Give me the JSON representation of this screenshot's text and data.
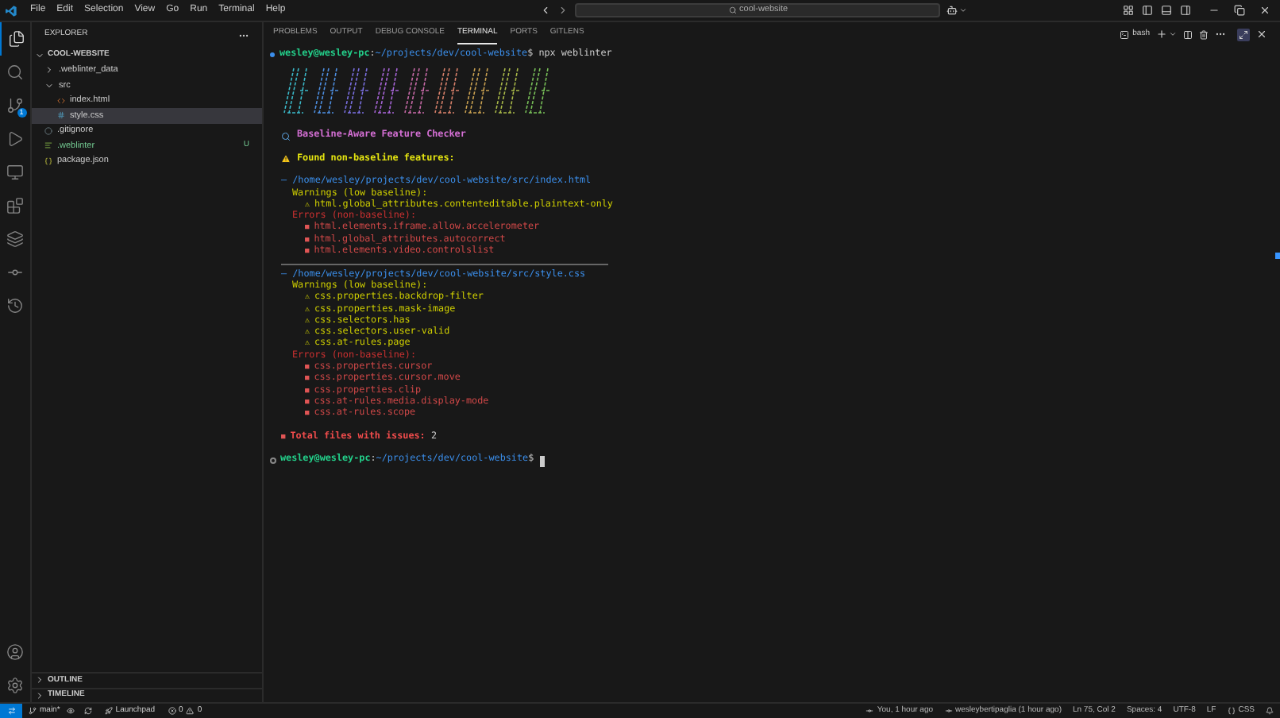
{
  "title_bar": {
    "menus": [
      "File",
      "Edit",
      "Selection",
      "View",
      "Go",
      "Run",
      "Terminal",
      "Help"
    ],
    "search": {
      "value": "cool-website"
    }
  },
  "activity_bar": {
    "items": [
      {
        "selected": true
      },
      {
        "selected": false
      },
      {
        "selected": false,
        "badge": "1"
      },
      {
        "selected": false
      },
      {
        "selected": false
      },
      {
        "selected": false
      },
      {
        "selected": false
      },
      {
        "selected": false
      },
      {
        "selected": false
      }
    ]
  },
  "sidebar": {
    "title": "EXPLORER",
    "root": {
      "label": "COOL-WEBSITE",
      "expanded": true,
      "children": [
        {
          "label": ".weblinter_data",
          "kind": "folder",
          "expanded": false,
          "selected": false
        },
        {
          "label": "src",
          "kind": "folder",
          "expanded": true,
          "selected": false,
          "children": [
            {
              "label": "index.html",
              "kind": "html",
              "selected": false
            },
            {
              "label": "style.css",
              "kind": "css",
              "selected": true
            }
          ]
        },
        {
          "label": ".gitignore",
          "kind": "git",
          "selected": false
        },
        {
          "label": ".weblinter",
          "kind": "config",
          "selected": false,
          "git_status": "U"
        },
        {
          "label": "package.json",
          "kind": "json",
          "selected": false
        }
      ]
    },
    "sections": [
      {
        "label": "OUTLINE",
        "expanded": false
      },
      {
        "label": "TIMELINE",
        "expanded": false
      }
    ]
  },
  "panel": {
    "tabs": [
      {
        "label": "PROBLEMS",
        "selected": false
      },
      {
        "label": "OUTPUT",
        "selected": false
      },
      {
        "label": "DEBUG CONSOLE",
        "selected": false
      },
      {
        "label": "TERMINAL",
        "selected": true
      },
      {
        "label": "PORTS",
        "selected": false
      },
      {
        "label": "GITLENS",
        "selected": false
      }
    ],
    "terminal_name": "bash",
    "lines": [
      {
        "kind": "prompt",
        "finished": true,
        "user": "wesley@wesley-pc",
        "sep": ":",
        "path": "~/projects/dev/cool-website",
        "symbol": "$",
        "command": "npx weblinter"
      },
      {
        "kind": "logo"
      },
      {
        "kind": "blank"
      },
      {
        "kind": "heading",
        "text": "Baseline-Aware Feature Checker"
      },
      {
        "kind": "blank"
      },
      {
        "kind": "notice",
        "text": "Found non-baseline features:"
      },
      {
        "kind": "blank"
      },
      {
        "kind": "file",
        "bullet": "–",
        "text": "/home/wesley/projects/dev/cool-website/src/index.html"
      },
      {
        "kind": "warn_group",
        "text": "Warnings (low baseline):"
      },
      {
        "kind": "warn",
        "bullet": "⚠",
        "text": "html.global_attributes.contenteditable.plaintext-only"
      },
      {
        "kind": "error_group",
        "text": "Errors (non-baseline):"
      },
      {
        "kind": "error",
        "bullet": "■",
        "text": "html.elements.iframe.allow.accelerometer"
      },
      {
        "kind": "error",
        "bullet": "■",
        "text": "html.global_attributes.autocorrect"
      },
      {
        "kind": "error",
        "bullet": "■",
        "text": "html.elements.video.controlslist"
      },
      {
        "kind": "separator"
      },
      {
        "kind": "file",
        "bullet": "–",
        "text": "/home/wesley/projects/dev/cool-website/src/style.css"
      },
      {
        "kind": "warn_group",
        "text": "Warnings (low baseline):"
      },
      {
        "kind": "warn",
        "bullet": "⚠",
        "text": "css.properties.backdrop-filter"
      },
      {
        "kind": "warn",
        "bullet": "⚠",
        "text": "css.properties.mask-image"
      },
      {
        "kind": "warn",
        "bullet": "⚠",
        "text": "css.selectors.has"
      },
      {
        "kind": "warn",
        "bullet": "⚠",
        "text": "css.selectors.user-valid"
      },
      {
        "kind": "warn",
        "bullet": "⚠",
        "text": "css.at-rules.page"
      },
      {
        "kind": "error_group",
        "text": "Errors (non-baseline):"
      },
      {
        "kind": "error",
        "bullet": "■",
        "text": "css.properties.cursor"
      },
      {
        "kind": "error",
        "bullet": "■",
        "text": "css.properties.cursor.move"
      },
      {
        "kind": "error",
        "bullet": "■",
        "text": "css.properties.clip"
      },
      {
        "kind": "error",
        "bullet": "■",
        "text": "css.at-rules.media.display-mode"
      },
      {
        "kind": "error",
        "bullet": "■",
        "text": "css.at-rules.scope"
      },
      {
        "kind": "blank"
      },
      {
        "kind": "total",
        "bullet": "■",
        "text": "Total files with issues:",
        "value": "2"
      },
      {
        "kind": "blank"
      },
      {
        "kind": "prompt",
        "finished": false,
        "user": "wesley@wesley-pc",
        "sep": ":",
        "path": "~/projects/dev/cool-website",
        "symbol": "$"
      }
    ]
  },
  "status_bar": {
    "branch": "main*",
    "launchpad": "Launchpad",
    "errors": "0",
    "warnings": "0",
    "right": [
      "You, 1 hour ago",
      "wesleybertipaglia (1 hour ago)",
      "Ln 75, Col 2",
      "Spaces: 4",
      "UTF-8",
      "LF",
      "CSS"
    ]
  }
}
